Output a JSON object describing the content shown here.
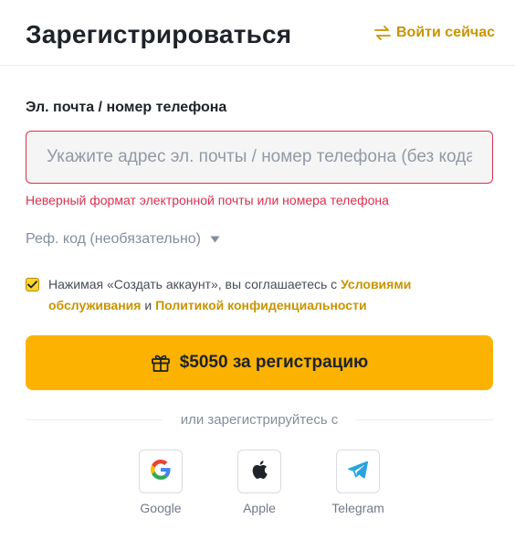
{
  "header": {
    "title": "Зарегистрироваться",
    "login_link": "Войти сейчас"
  },
  "form": {
    "email_label": "Эл. почта / номер телефона",
    "email_placeholder": "Укажите адрес эл. почты / номер телефона (без кода страны)",
    "email_value": "",
    "error_text": "Неверный формат электронной почты или номера телефона",
    "ref_label": "Реф. код (необязательно)",
    "terms_checked": true,
    "terms_prefix": "Нажимая «Создать аккаунт», вы соглашаетесь с ",
    "terms_link": "Условиями обслуживания",
    "terms_and": " и ",
    "privacy_link": "Политикой конфиденциальности",
    "submit_label": "$5050 за регистрацию"
  },
  "divider_text": "или зарегистрируйтесь с",
  "socials": [
    {
      "name": "Google",
      "icon": "google-icon"
    },
    {
      "name": "Apple",
      "icon": "apple-icon"
    },
    {
      "name": "Telegram",
      "icon": "telegram-icon"
    }
  ],
  "colors": {
    "accent": "#fcb200",
    "link": "#c99400",
    "error": "#d9304e"
  }
}
